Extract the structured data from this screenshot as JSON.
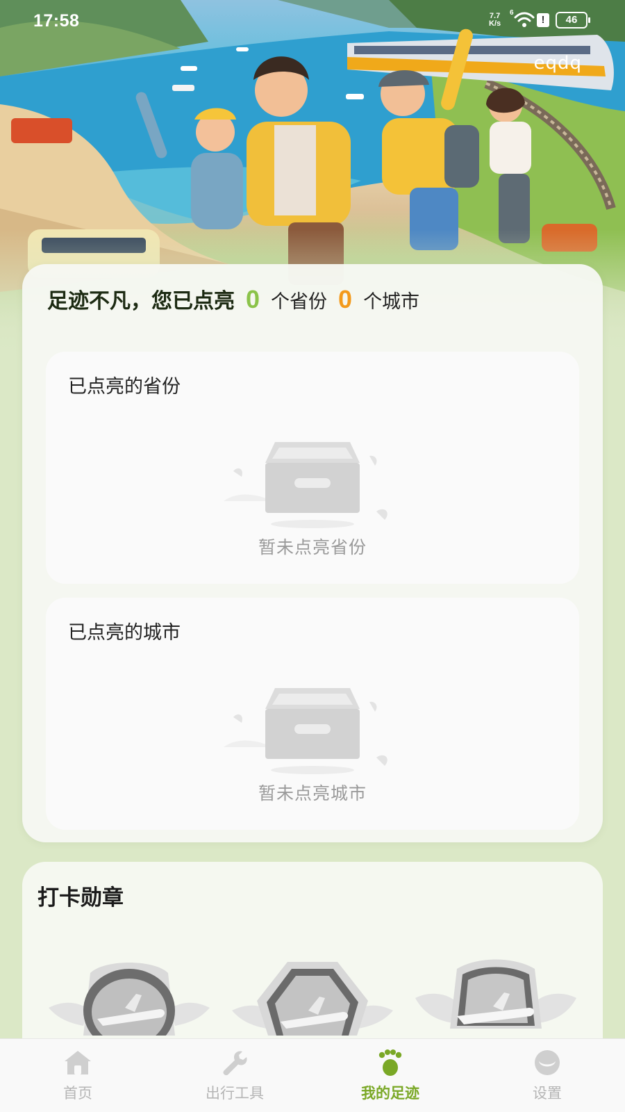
{
  "status_bar": {
    "time": "17:58",
    "net_speed_value": "7.7",
    "net_speed_unit": "K/s",
    "wifi_level": "6",
    "battery": "46"
  },
  "header": {
    "user_name": "eqdq"
  },
  "summary": {
    "lead": "足迹不凡，您已点亮",
    "province_count": "0",
    "province_unit": "个省份",
    "city_count": "0",
    "city_unit": "个城市"
  },
  "lit_provinces": {
    "title": "已点亮的省份",
    "empty_text": "暂未点亮省份"
  },
  "lit_cities": {
    "title": "已点亮的城市",
    "empty_text": "暂未点亮城市"
  },
  "badges": {
    "title": "打卡勋章",
    "items": [
      {
        "icon": "plane-badge-icon"
      },
      {
        "icon": "plane-badge-icon"
      },
      {
        "icon": "plane-badge-icon"
      }
    ]
  },
  "bottom_nav": {
    "items": [
      {
        "label": "首页",
        "icon": "home-icon",
        "active": false
      },
      {
        "label": "出行工具",
        "icon": "wrench-icon",
        "active": false
      },
      {
        "label": "我的足迹",
        "icon": "footprint-icon",
        "active": true
      },
      {
        "label": "设置",
        "icon": "settings-icon",
        "active": false
      }
    ]
  },
  "colors": {
    "accent_green": "#7aa826",
    "count_green": "#8bc34a",
    "count_orange": "#f39a1c",
    "page_background": "#dbe8c6"
  }
}
